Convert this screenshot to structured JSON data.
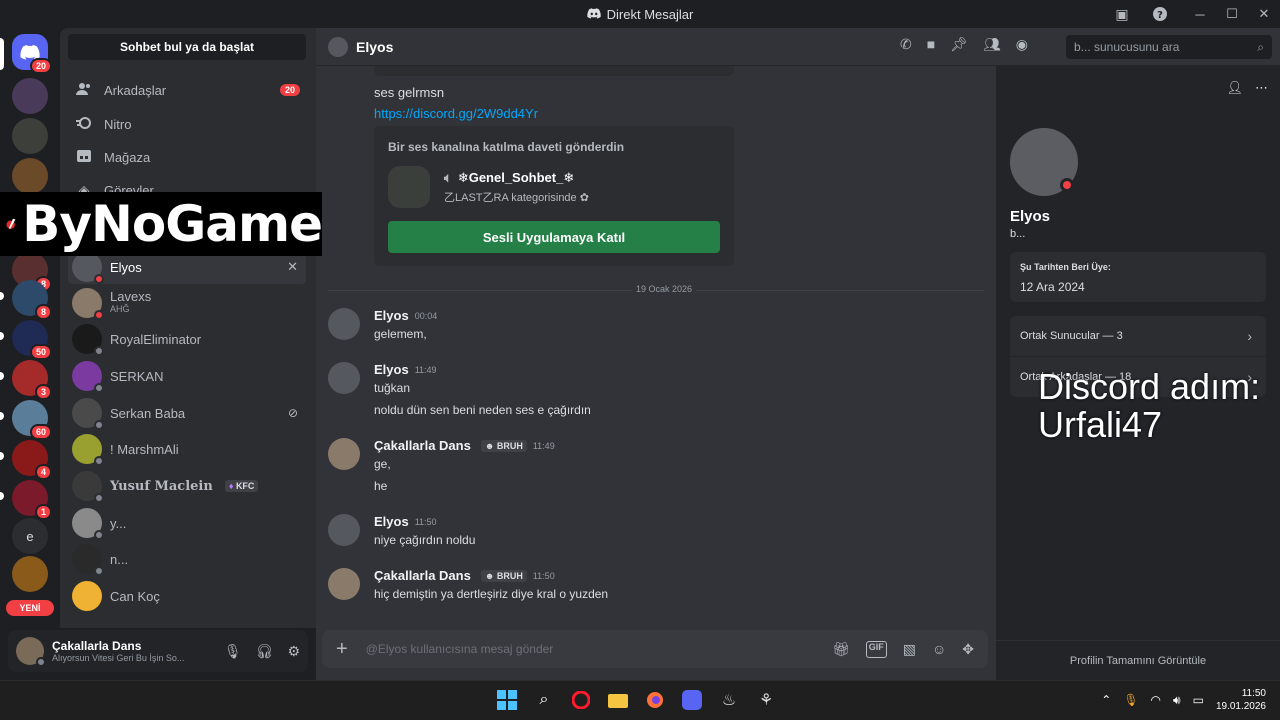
{
  "window": {
    "title": "Direkt Mesajlar"
  },
  "colors": {
    "accent": "#5865f2",
    "online": "#23a55a",
    "dnd": "#f23f43",
    "join": "#248046",
    "link": "#00a8fc"
  },
  "rail": {
    "home_badge": "20",
    "servers": [
      {
        "badge": ""
      },
      {
        "badge": ""
      },
      {
        "badge": ""
      },
      {
        "badge": "8"
      },
      {
        "badge": "8"
      },
      {
        "badge": "50"
      },
      {
        "badge": "3"
      },
      {
        "badge": "60"
      },
      {
        "badge": "4"
      },
      {
        "badge": "1"
      }
    ],
    "letter_server": "e",
    "new_label": "YENİ"
  },
  "sidebar": {
    "find_label": "Sohbet bul ya da başlat",
    "nav": [
      {
        "label": "Arkadaşlar",
        "icon": "friends-icon",
        "count": "20"
      },
      {
        "label": "Nitro",
        "icon": "nitro-icon",
        "count": ""
      },
      {
        "label": "Mağaza",
        "icon": "shop-icon",
        "count": ""
      },
      {
        "label": "Görevler",
        "icon": "quests-icon",
        "count": ""
      }
    ],
    "dms": [
      {
        "name": "Elyos",
        "sub": "",
        "tag": ""
      },
      {
        "name": "Lavexs",
        "sub": "AHĞ",
        "tag": ""
      },
      {
        "name": "RoyalEliminator",
        "sub": "",
        "tag": ""
      },
      {
        "name": "SERKAN",
        "sub": "",
        "tag": ""
      },
      {
        "name": "Serkan Baba",
        "sub": "",
        "tag": ""
      },
      {
        "name": "! MarshmAli",
        "sub": "",
        "tag": ""
      },
      {
        "name": "Yusuf Maclein",
        "sub": "",
        "tag": "KFC"
      },
      {
        "name": "y...",
        "sub": "",
        "tag": ""
      },
      {
        "name": "n...",
        "sub": "",
        "tag": ""
      },
      {
        "name": "Can Koç",
        "sub": "",
        "tag": ""
      }
    ]
  },
  "user_panel": {
    "name": "Çakallarla Dans",
    "status": "Alıyorsun Vitesi Geri Bu İşin So..."
  },
  "chat": {
    "header_name": "Elyos",
    "search_placeholder": "b... sunucusunu ara",
    "top_msg": "ses gelrmsn",
    "top_link": "https://discord.gg/2W9dd4Yr",
    "invite": {
      "heading": "Bir ses kanalına katılma daveti gönderdin",
      "channel": "❄Genel_Sohbet_❄",
      "category": "乙LAST乙RA kategorisinde",
      "join_label": "Sesli Uygulamaya Katıl"
    },
    "date_divider": "19 Ocak 2026",
    "messages": [
      {
        "author": "Elyos",
        "tag": "",
        "time": "00:04",
        "lines": [
          "gelemem,"
        ]
      },
      {
        "author": "Elyos",
        "tag": "",
        "time": "11:49",
        "lines": [
          "tuğkan",
          "noldu dün sen beni neden ses e çağırdın"
        ]
      },
      {
        "author": "Çakallarla Dans",
        "tag": "BRUH",
        "time": "11:49",
        "lines": [
          "ge,",
          "he"
        ]
      },
      {
        "author": "Elyos",
        "tag": "",
        "time": "11:50",
        "lines": [
          "niye çağırdın noldu"
        ]
      },
      {
        "author": "Çakallarla Dans",
        "tag": "BRUH",
        "time": "11:50",
        "lines": [
          "hiç demiştin ya dertleşiriz diye kral o yuzden"
        ]
      }
    ],
    "composer_placeholder": "@Elyos kullanıcısına mesaj gönder"
  },
  "profile": {
    "name": "Elyos",
    "username": "b...",
    "member_since_label": "Şu Tarihten Beri Üye:",
    "member_since": "12 Ara 2024",
    "mutual_servers": "Ortak Sunucular — 3",
    "mutual_friends": "Ortak Arkadaşlar — 18",
    "view_full": "Profilin Tamamını Görüntüle"
  },
  "overlay": {
    "watermark": "ByNoGame",
    "caption_line1": "Discord adım:",
    "caption_line2": "Urfali47"
  },
  "taskbar": {
    "time": "11:50",
    "date": "19.01.2026"
  }
}
